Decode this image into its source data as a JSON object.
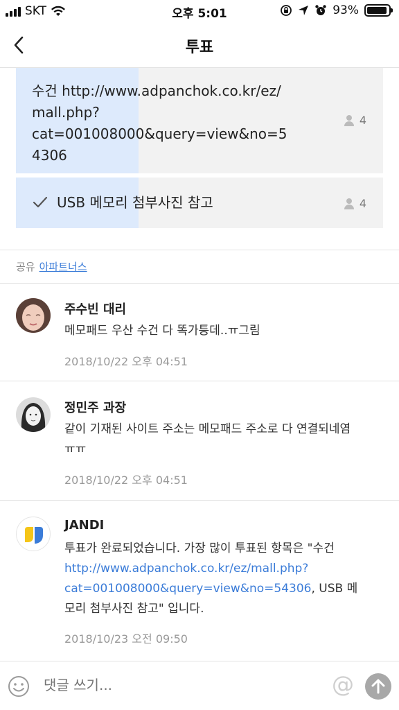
{
  "status_bar": {
    "carrier": "SKT",
    "time": "오후 5:01",
    "battery": "93%",
    "battery_level": 0.93
  },
  "nav": {
    "title": "투표"
  },
  "poll": {
    "options": [
      {
        "lines": [
          "수건 http://www.adpanchok.co.kr/ez/",
          "mall.php?",
          "cat=001008000&query=view&no=5",
          "4306"
        ],
        "votes": "4",
        "checked": false
      },
      {
        "label": "USB 메모리 첨부사진 참고",
        "votes": "4",
        "checked": true
      }
    ]
  },
  "share": {
    "label": "공유",
    "link": "아파트너스"
  },
  "comments": [
    {
      "name": "주수빈 대리",
      "text": "메모패드 우산 수건 다 똑가틍데..ㅠ그림",
      "time": "2018/10/22 오후 04:51"
    },
    {
      "name": "정민주 과장",
      "text_line1": "같이 기재된 사이트 주소는 메모패드 주소로 다 연결되네염",
      "text_line2": "ㅠㅠ",
      "time": "2018/10/22 오후 04:51"
    },
    {
      "name": "JANDI",
      "text_part1": "투표가 완료되었습니다. 가장 많이 투표된 항목은 \"수건",
      "link_line1": "http://www.adpanchok.co.kr/ez/mall.php?",
      "link_line2": "cat=001008000&query=view&no=54306",
      "text_part2": ", USB 메",
      "text_part3": "모리 첨부사진 참고\" 입니다.",
      "time": "2018/10/23 오전 09:50"
    }
  ],
  "composer": {
    "placeholder": "댓글 쓰기...",
    "at_symbol": "@"
  },
  "colors": {
    "link": "#3b7cd8",
    "vote_bar": "#ddeafc",
    "option_bg": "#f2f2f2"
  }
}
